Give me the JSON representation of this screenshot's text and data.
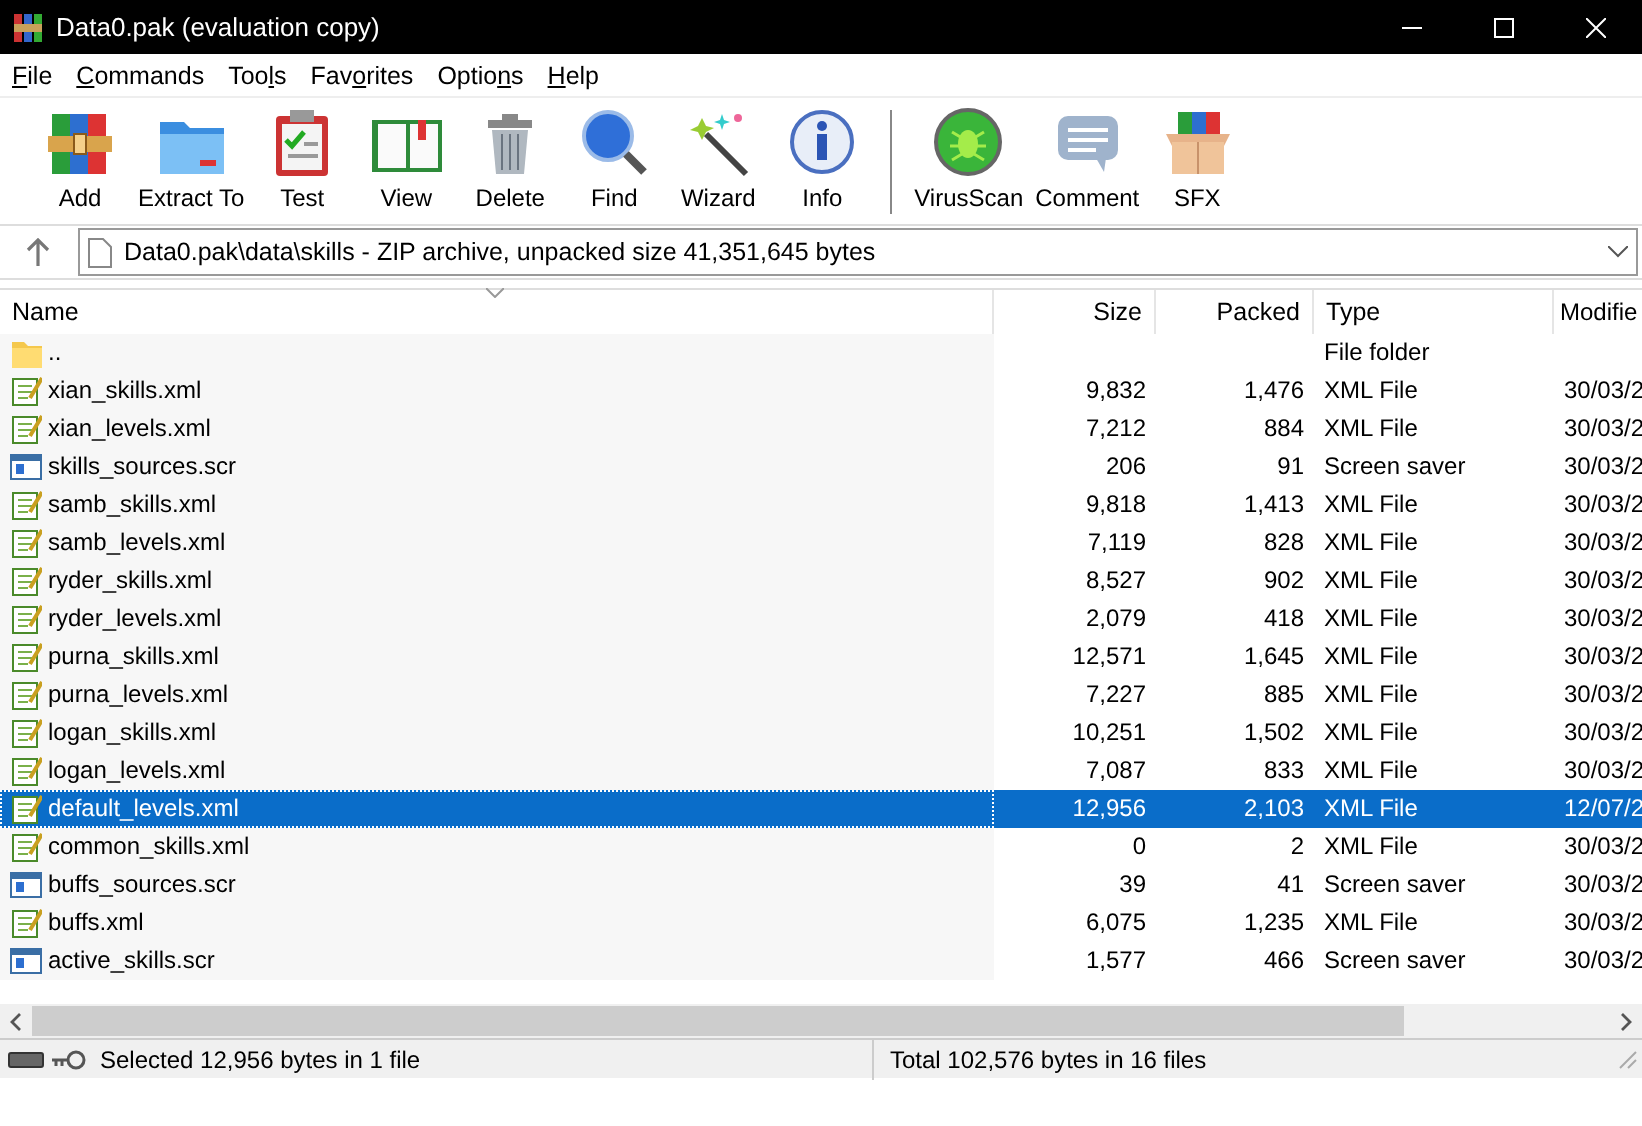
{
  "window": {
    "title": "Data0.pak (evaluation copy)"
  },
  "menu": [
    {
      "parts": [
        {
          "text": "F",
          "underlined": true
        },
        {
          "text": "ile",
          "underlined": false
        }
      ]
    },
    {
      "parts": [
        {
          "text": "C",
          "underlined": true
        },
        {
          "text": "ommands",
          "underlined": false
        }
      ]
    },
    {
      "parts": [
        {
          "text": "Too",
          "underlined": false
        },
        {
          "text": "l",
          "underlined": true
        },
        {
          "text": "s",
          "underlined": false
        }
      ]
    },
    {
      "parts": [
        {
          "text": "Fav",
          "underlined": false
        },
        {
          "text": "o",
          "underlined": true
        },
        {
          "text": "rites",
          "underlined": false
        }
      ]
    },
    {
      "parts": [
        {
          "text": "Optio",
          "underlined": false
        },
        {
          "text": "n",
          "underlined": true
        },
        {
          "text": "s",
          "underlined": false
        }
      ]
    },
    {
      "parts": [
        {
          "text": "H",
          "underlined": true
        },
        {
          "text": "elp",
          "underlined": false
        }
      ]
    }
  ],
  "toolbar": [
    {
      "label": "Add",
      "kind": "archive"
    },
    {
      "label": "Extract To",
      "kind": "folder"
    },
    {
      "label": "Test",
      "kind": "clipboard"
    },
    {
      "label": "View",
      "kind": "book"
    },
    {
      "label": "Delete",
      "kind": "trash"
    },
    {
      "label": "Find",
      "kind": "search"
    },
    {
      "label": "Wizard",
      "kind": "wand"
    },
    {
      "label": "Info",
      "kind": "info"
    },
    {
      "kind": "separator"
    },
    {
      "label": "VirusScan",
      "kind": "bug"
    },
    {
      "label": "Comment",
      "kind": "comment"
    },
    {
      "label": "SFX",
      "kind": "box"
    }
  ],
  "address": {
    "path": "Data0.pak\\data\\skills - ZIP archive, unpacked size 41,351,645 bytes"
  },
  "table": {
    "columns": [
      "Name",
      "Size",
      "Packed",
      "Type",
      "Modifie"
    ],
    "rows": [
      {
        "name": "..",
        "size": "",
        "packed": "",
        "type": "File folder",
        "modified": "",
        "kind": "folder",
        "selected": false
      },
      {
        "name": "xian_skills.xml",
        "size": "9,832",
        "packed": "1,476",
        "type": "XML File",
        "modified": "30/03/2",
        "kind": "xml",
        "selected": false
      },
      {
        "name": "xian_levels.xml",
        "size": "7,212",
        "packed": "884",
        "type": "XML File",
        "modified": "30/03/2",
        "kind": "xml",
        "selected": false
      },
      {
        "name": "skills_sources.scr",
        "size": "206",
        "packed": "91",
        "type": "Screen saver",
        "modified": "30/03/2",
        "kind": "scr",
        "selected": false
      },
      {
        "name": "samb_skills.xml",
        "size": "9,818",
        "packed": "1,413",
        "type": "XML File",
        "modified": "30/03/2",
        "kind": "xml",
        "selected": false
      },
      {
        "name": "samb_levels.xml",
        "size": "7,119",
        "packed": "828",
        "type": "XML File",
        "modified": "30/03/2",
        "kind": "xml",
        "selected": false
      },
      {
        "name": "ryder_skills.xml",
        "size": "8,527",
        "packed": "902",
        "type": "XML File",
        "modified": "30/03/2",
        "kind": "xml",
        "selected": false
      },
      {
        "name": "ryder_levels.xml",
        "size": "2,079",
        "packed": "418",
        "type": "XML File",
        "modified": "30/03/2",
        "kind": "xml",
        "selected": false
      },
      {
        "name": "purna_skills.xml",
        "size": "12,571",
        "packed": "1,645",
        "type": "XML File",
        "modified": "30/03/2",
        "kind": "xml",
        "selected": false
      },
      {
        "name": "purna_levels.xml",
        "size": "7,227",
        "packed": "885",
        "type": "XML File",
        "modified": "30/03/2",
        "kind": "xml",
        "selected": false
      },
      {
        "name": "logan_skills.xml",
        "size": "10,251",
        "packed": "1,502",
        "type": "XML File",
        "modified": "30/03/2",
        "kind": "xml",
        "selected": false
      },
      {
        "name": "logan_levels.xml",
        "size": "7,087",
        "packed": "833",
        "type": "XML File",
        "modified": "30/03/2",
        "kind": "xml",
        "selected": false
      },
      {
        "name": "default_levels.xml",
        "size": "12,956",
        "packed": "2,103",
        "type": "XML File",
        "modified": "12/07/2",
        "kind": "xml",
        "selected": true
      },
      {
        "name": "common_skills.xml",
        "size": "0",
        "packed": "2",
        "type": "XML File",
        "modified": "30/03/2",
        "kind": "xml",
        "selected": false
      },
      {
        "name": "buffs_sources.scr",
        "size": "39",
        "packed": "41",
        "type": "Screen saver",
        "modified": "30/03/2",
        "kind": "scr",
        "selected": false
      },
      {
        "name": "buffs.xml",
        "size": "6,075",
        "packed": "1,235",
        "type": "XML File",
        "modified": "30/03/2",
        "kind": "xml",
        "selected": false
      },
      {
        "name": "active_skills.scr",
        "size": "1,577",
        "packed": "466",
        "type": "Screen saver",
        "modified": "30/03/2",
        "kind": "scr",
        "selected": false
      }
    ]
  },
  "status_bar": {
    "selected": "Selected 12,956 bytes in 1 file",
    "total": "Total 102,576 bytes in 16 files"
  }
}
